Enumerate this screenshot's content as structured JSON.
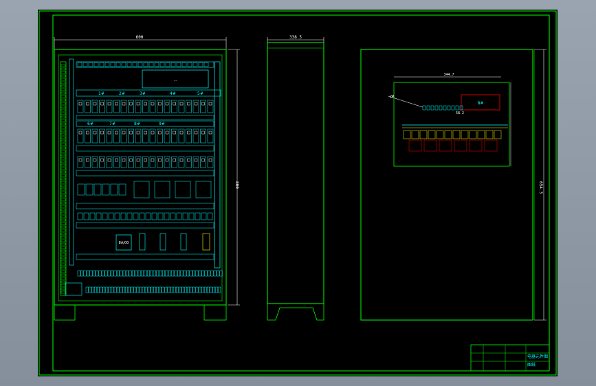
{
  "drawing": {
    "front_width_label": "600",
    "side_depth_label": "338.5",
    "front_height_label": "800",
    "inner_width_label": "344.7",
    "inner_height_label": "654.3",
    "top_display_text": "...",
    "zone_row_1": [
      "1#",
      "2#",
      "3#",
      "4#",
      "5#"
    ],
    "zone_row_2": [
      "6#",
      "7#",
      "8#",
      "9#"
    ],
    "callout_text": "8#",
    "side_dims": [
      "2#",
      "58.2"
    ],
    "module_label": "8A/00",
    "title_block": {
      "title_line_1": "电器元件图",
      "title_line_2": "图纸"
    }
  },
  "colors": {
    "frame_green": "#00ff00",
    "cyan": "#00ffff",
    "white": "#ffffff",
    "yellow": "#ffff00",
    "red": "#ff0000",
    "magenta": "#ff00ff"
  }
}
